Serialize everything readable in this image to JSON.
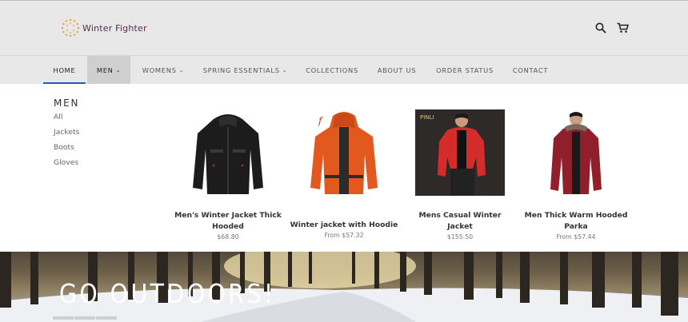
{
  "brand": {
    "name": "Winter Fighter",
    "logo_icon": "sun-dots-logo",
    "text_color": "#5a2b4f"
  },
  "header": {
    "icons": [
      "search-icon",
      "cart-icon"
    ]
  },
  "nav": {
    "accent_color": "#1f5cb8",
    "items": [
      {
        "label": "HOME",
        "active": true
      },
      {
        "label": "MEN",
        "open": true,
        "dropdown": true
      },
      {
        "label": "WOMENS",
        "dropdown": true
      },
      {
        "label": "SPRING ESSENTIALS",
        "dropdown": true
      },
      {
        "label": "COLLECTIONS"
      },
      {
        "label": "ABOUT US"
      },
      {
        "label": "ORDER STATUS"
      },
      {
        "label": "CONTACT"
      }
    ],
    "caret": "⌄"
  },
  "mega_menu": {
    "title": "MEN",
    "links": [
      "All",
      "Jackets",
      "Boots",
      "Gloves"
    ],
    "products": [
      {
        "name_line1": "Men's Winter Jacket Thick",
        "name_line2": "Hooded",
        "price": "$68.80"
      },
      {
        "name_line1": "Winter jacket with Hoodie",
        "name_line2": "",
        "price": "From $57.32",
        "badge": "f"
      },
      {
        "name_line1": "Mens Casual Winter",
        "name_line2": "Jacket",
        "price": "$155.50",
        "image_label": "PINLI"
      },
      {
        "name_line1": "Men Thick Warm Hooded",
        "name_line2": "Parka",
        "price": "From $57.44"
      }
    ]
  },
  "banner": {
    "title": "GO OUTDOORS!"
  }
}
